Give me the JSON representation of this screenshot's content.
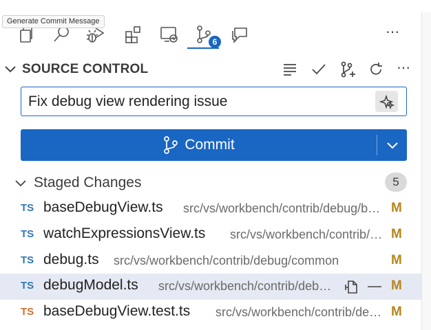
{
  "tooltip": "Generate Commit Message",
  "activity_bar": {
    "icons": [
      "explorer-icon",
      "search-icon",
      "run-debug-icon",
      "extensions-icon",
      "remote-explorer-icon",
      "source-control-icon",
      "chat-icon"
    ],
    "source_control_badge": "6",
    "more": "⋯"
  },
  "section": {
    "title": "SOURCE CONTROL",
    "toolbar": [
      "view-as-tree-icon",
      "commit-check-icon",
      "create-pull-request-icon",
      "refresh-icon"
    ],
    "more": "⋯"
  },
  "commit_message": {
    "value": "Fix debug view rendering issue"
  },
  "commit_button": {
    "label": "Commit"
  },
  "staged_group": {
    "title": "Staged Changes",
    "count": "5"
  },
  "files": [
    {
      "lang": "TS",
      "name": "baseDebugView.ts",
      "path": "src/vs/workbench/contrib/debug/browser",
      "status": "M",
      "selected": false,
      "test": false
    },
    {
      "lang": "TS",
      "name": "watchExpressionsView.ts",
      "path": "src/vs/workbench/contrib/debug/browser",
      "status": "M",
      "selected": false,
      "test": false
    },
    {
      "lang": "TS",
      "name": "debug.ts",
      "path": "src/vs/workbench/contrib/debug/common",
      "status": "M",
      "selected": false,
      "test": false
    },
    {
      "lang": "TS",
      "name": "debugModel.ts",
      "path": "src/vs/workbench/contrib/debug/common",
      "status": "M",
      "selected": true,
      "test": false
    },
    {
      "lang": "TS",
      "name": "baseDebugView.test.ts",
      "path": "src/vs/workbench/contrib/debug/test/browser",
      "status": "M",
      "selected": false,
      "test": true
    }
  ],
  "colors": {
    "accent": "#1a66c3",
    "modified": "#b8861b",
    "ts": "#3278b2",
    "test_ts": "#d46d2a",
    "selected_row": "#e5e9f3"
  }
}
